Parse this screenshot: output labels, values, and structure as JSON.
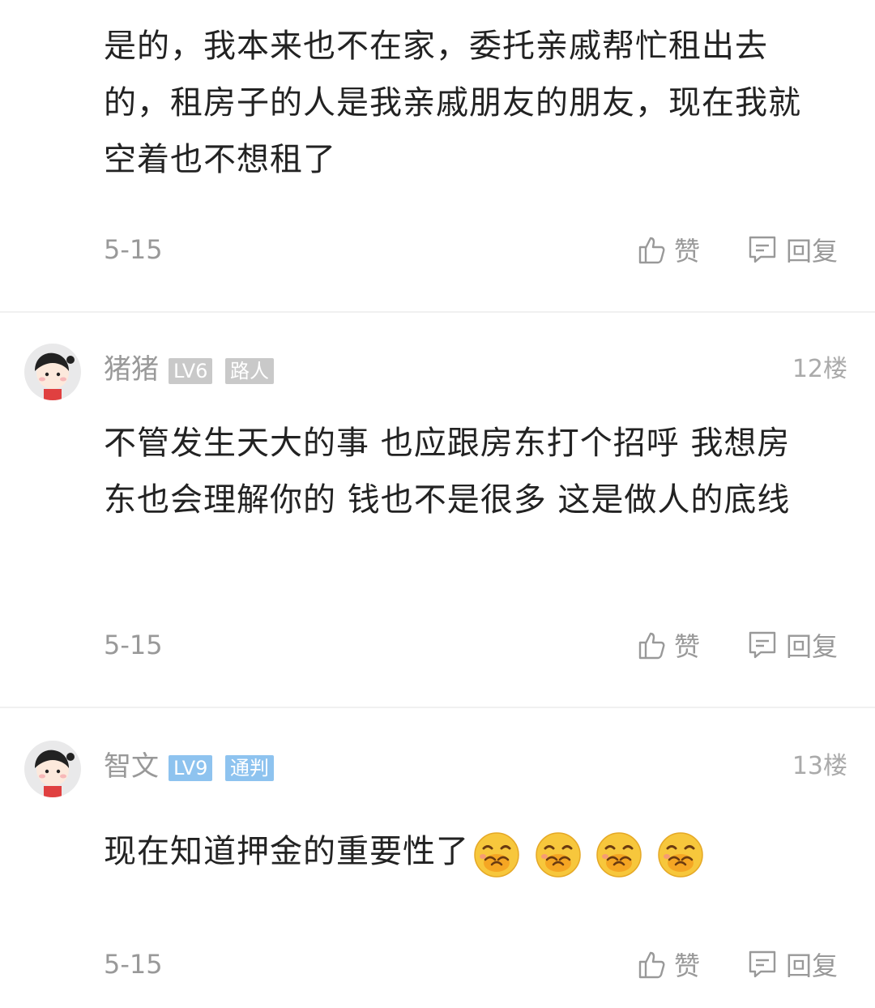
{
  "comments": [
    {
      "text": "是的，我本来也不在家，委托亲戚帮忙租出去的，租房子的人是我亲戚朋友的朋友，现在我就空着也不想租了",
      "date": "5-15",
      "like_label": "赞",
      "reply_label": "回复"
    },
    {
      "username": "猪猪",
      "level": "LV6",
      "title": "路人",
      "level_color": "#c9c9c9",
      "title_color": "#c9c9c9",
      "floor": "12楼",
      "text": "不管发生天大的事 也应跟房东打个招呼  我想房东也会理解你的 钱也不是很多 这是做人的底线",
      "date": "5-15",
      "like_label": "赞",
      "reply_label": "回复"
    },
    {
      "username": "智文",
      "level": "LV9",
      "title": "通判",
      "level_color": "#8ec3ef",
      "title_color": "#8ec3ef",
      "floor": "13楼",
      "text": "现在知道押金的重要性了",
      "emojis": [
        "covering-mouth-laugh-emoji",
        "covering-mouth-laugh-emoji",
        "covering-mouth-laugh-emoji",
        "covering-mouth-laugh-emoji"
      ],
      "date": "5-15",
      "like_label": "赞",
      "reply_label": "回复"
    }
  ],
  "icons": {
    "like": "thumbs-up-icon",
    "reply": "speech-bubble-icon"
  }
}
